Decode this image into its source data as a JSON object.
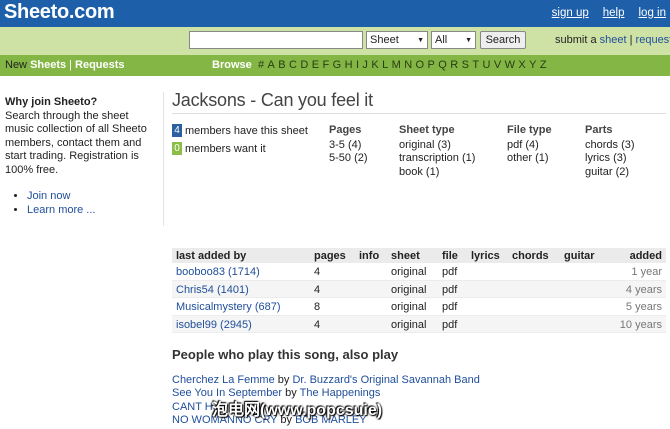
{
  "header": {
    "logo": "Sheeto.com",
    "links": [
      "sign up",
      "help",
      "log in"
    ]
  },
  "search": {
    "value": "",
    "type_selected": "Sheet",
    "scope_selected": "All",
    "button_label": "Search",
    "submit_prefix": "submit a",
    "submit_sheet": "sheet",
    "submit_sep": "|",
    "submit_request": "request"
  },
  "nav": {
    "new_label": "New",
    "sheets_label": "Sheets",
    "sep": "|",
    "requests_label": "Requests",
    "browse_label": "Browse",
    "letters": [
      "#",
      "A",
      "B",
      "C",
      "D",
      "E",
      "F",
      "G",
      "H",
      "I",
      "J",
      "K",
      "L",
      "M",
      "N",
      "O",
      "P",
      "Q",
      "R",
      "S",
      "T",
      "U",
      "V",
      "W",
      "X",
      "Y",
      "Z"
    ]
  },
  "sidebar": {
    "heading": "Why join Sheeto?",
    "body": "Search through the sheet music collection of all Sheeto members, contact them and start trading. Registration is 100% free.",
    "links": [
      "Join now",
      "Learn more ..."
    ]
  },
  "song": {
    "title": "Jacksons - Can you feel it",
    "have_count": "4",
    "have_text": "members have this sheet",
    "want_count": "0",
    "want_text": "members want it"
  },
  "facets": [
    {
      "title": "Pages",
      "items": [
        "3-5 (4)",
        "5-50 (2)"
      ]
    },
    {
      "title": "Sheet type",
      "items": [
        "original (3)",
        "transcription (1)",
        "book (1)"
      ]
    },
    {
      "title": "File type",
      "items": [
        "pdf (4)",
        "other (1)"
      ]
    },
    {
      "title": "Parts",
      "items": [
        "chords (3)",
        "lyrics (3)",
        "guitar (2)"
      ]
    }
  ],
  "table": {
    "headers": [
      "last added by",
      "pages",
      "info",
      "sheet",
      "file",
      "lyrics",
      "chords",
      "guitar",
      "added"
    ],
    "rows": [
      {
        "user": "booboo83 (1714)",
        "pages": "4",
        "sheet": "original",
        "file": "pdf",
        "added": "1 year"
      },
      {
        "user": "Chris54 (1401)",
        "pages": "4",
        "sheet": "original",
        "file": "pdf",
        "added": "4 years"
      },
      {
        "user": "Musicalmystery (687)",
        "pages": "8",
        "sheet": "original",
        "file": "pdf",
        "added": "5 years"
      },
      {
        "user": "isobel99 (2945)",
        "pages": "4",
        "sheet": "original",
        "file": "pdf",
        "added": "10 years"
      }
    ]
  },
  "also": {
    "title": "People who play this song, also play",
    "by_word": "by",
    "items": [
      {
        "song": "Cherchez La Femme",
        "artist": "Dr. Buzzard's Original Savannah Band"
      },
      {
        "song": "See You In September",
        "artist": "The Happenings"
      },
      {
        "song": "CANT H",
        "artist": ""
      },
      {
        "song": "NO WOMANNO CRY",
        "artist": "BOB MARLEY"
      }
    ]
  },
  "watermark": "泡电网(www.popcsuie)"
}
